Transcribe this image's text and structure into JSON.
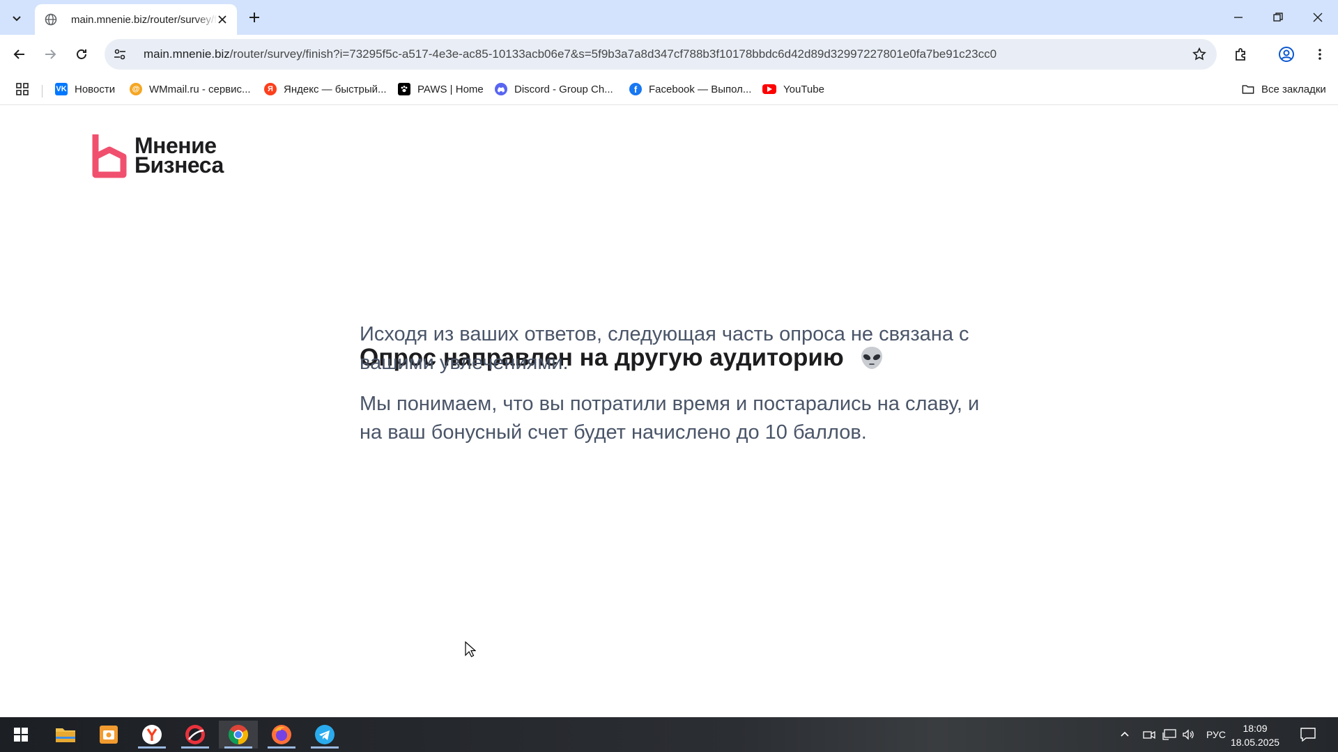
{
  "browser": {
    "tab_title": "main.mnenie.biz/router/survey/finish",
    "url_host": "main.mnenie.biz",
    "url_path": "/router/survey/finish?i=73295f5c-a517-4e3e-ac85-10133acb06e7&s=5f9b3a7a8d347cf788b3f10178bbdc6d42d89d32997227801e0fa7be91c23cc0",
    "bookmarks": [
      {
        "label": "Новости",
        "icon": "vk-icon",
        "color": "#0077ff"
      },
      {
        "label": "WMmail.ru - сервис...",
        "icon": "wmmail-icon",
        "color": "#f5a623"
      },
      {
        "label": "Яндекс — быстрый...",
        "icon": "yandex-icon",
        "color": "#fc3f1d"
      },
      {
        "label": "PAWS | Home",
        "icon": "paws-icon",
        "color": "#000000"
      },
      {
        "label": "Discord - Group Ch...",
        "icon": "discord-icon",
        "color": "#5865f2"
      },
      {
        "label": "Facebook — Выпол...",
        "icon": "facebook-icon",
        "color": "#1877f2"
      },
      {
        "label": "YouTube",
        "icon": "youtube-icon",
        "color": "#ff0000"
      }
    ],
    "all_bookmarks": "Все закладки"
  },
  "page": {
    "logo_line1": "Мнение",
    "logo_line2": "Бизнеса",
    "logo_color": "#f0506e",
    "heading": "Опрос направлен на другую аудиторию",
    "paragraph1": "Исходя из ваших ответов, следующая часть опроса не связана с вашими увлечениями.",
    "paragraph2": "Мы понимаем, что вы потратили время и постарались на славу, и на ваш бонусный счет будет начислено до 10 баллов."
  },
  "taskbar": {
    "language": "РУС",
    "time": "18:09",
    "date": "18.05.2025"
  }
}
